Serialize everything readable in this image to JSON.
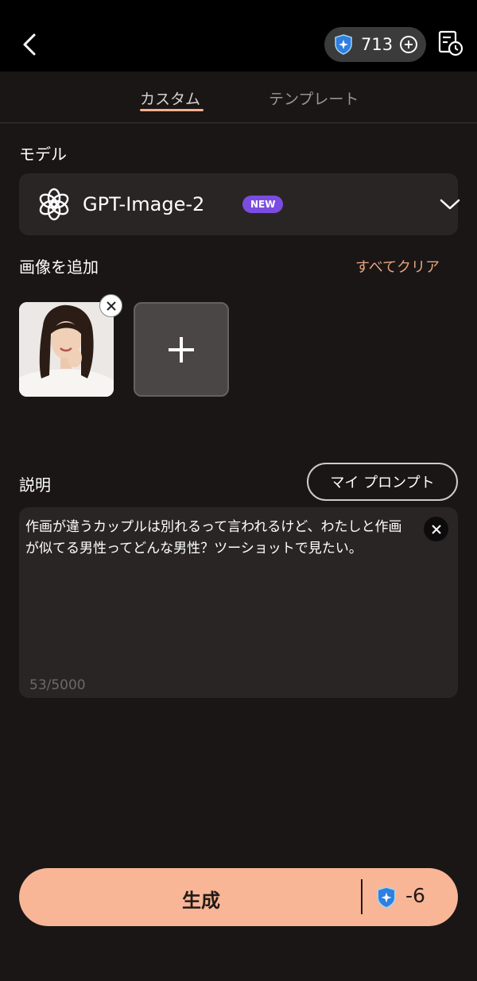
{
  "header": {
    "back_icon": "chevron-left-icon",
    "credits": "713",
    "credit_icon": "shield-sparkle-icon",
    "add_credits_icon": "plus-circle-icon",
    "history_icon": "document-clock-icon"
  },
  "tabs": [
    {
      "label": "カスタム",
      "active": true
    },
    {
      "label": "テンプレート",
      "active": false
    }
  ],
  "model": {
    "section_label": "モデル",
    "name": "GPT-Image-2",
    "badge": "NEW",
    "icon": "openai-logo-icon"
  },
  "images": {
    "section_label": "画像を追加",
    "clear_all": "すべてクリア",
    "add_icon": "plus-icon",
    "remove_icon": "close-icon"
  },
  "description": {
    "section_label": "説明",
    "my_prompt_button": "マイ プロンプト",
    "text": "作画が違うカップルは別れるって言われるけど、わたしと作画が似てる男性ってどんな男性？ツーショットで見たい。",
    "char_count": "53/5000"
  },
  "generate": {
    "label": "生成",
    "cost": "-6"
  },
  "colors": {
    "accent": "#f8b696",
    "badge": "#7b4ce0",
    "clear_all_text": "#e8a47f",
    "background": "#1a1616"
  }
}
